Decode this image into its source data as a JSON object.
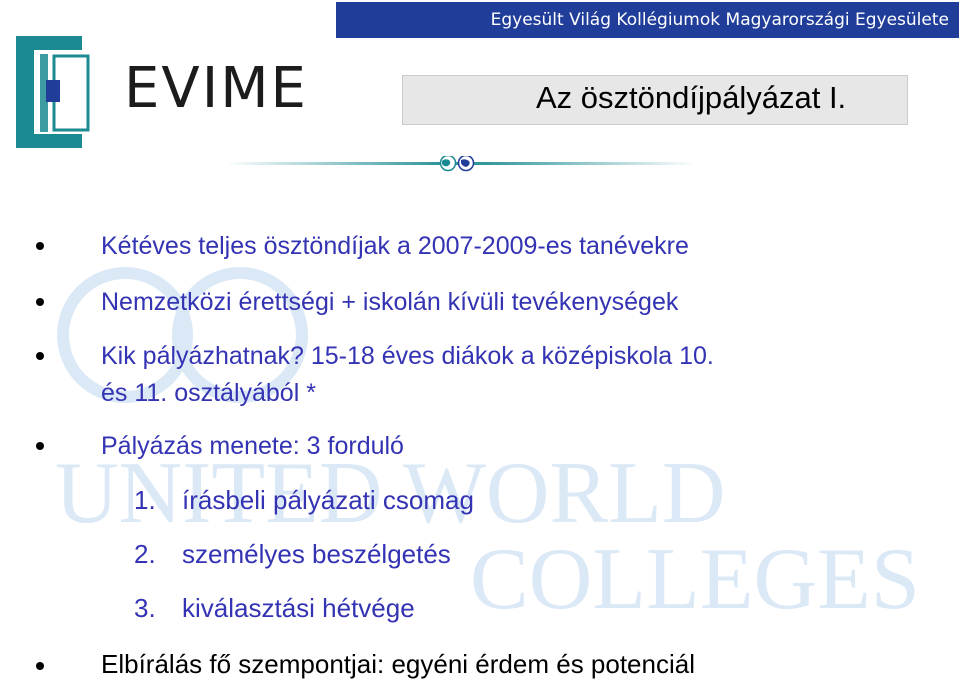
{
  "header": {
    "organization": "Egyesült Világ Kollégiumok Magyarországi Egyesülete",
    "logo_text": "EVIME",
    "slide_title": "Az ösztöndíjpályázat I.",
    "banner_color": "#1f3d99"
  },
  "watermark": {
    "line1": "UNITED WORLD",
    "line2": "COLLEGES",
    "color": "#dbe8f6"
  },
  "bullets": [
    {
      "text": "Kétéves teljes ösztöndíjak a 2007-2009-es tanévekre"
    },
    {
      "text": "Nemzetközi érettségi + iskolán kívüli tevékenységek"
    },
    {
      "line1": "Kik pályázhatnak? 15-18 éves diákok a középiskola 10.",
      "line2": "és 11. osztályából *"
    },
    {
      "text": "Pályázás menete: 3 forduló"
    }
  ],
  "steps": [
    {
      "number": "1.",
      "text": "írásbeli pályázati csomag"
    },
    {
      "number": "2.",
      "text": "személyes beszélgetés"
    },
    {
      "number": "3.",
      "text": "kiválasztási hétvége"
    }
  ],
  "final_bullet": {
    "text": "Elbírálás fő szempontjai: egyéni érdem és potenciál"
  },
  "colors": {
    "body_text": "#3333b3",
    "logo_teal": "#1b8a92",
    "logo_blue": "#1f3d99"
  }
}
